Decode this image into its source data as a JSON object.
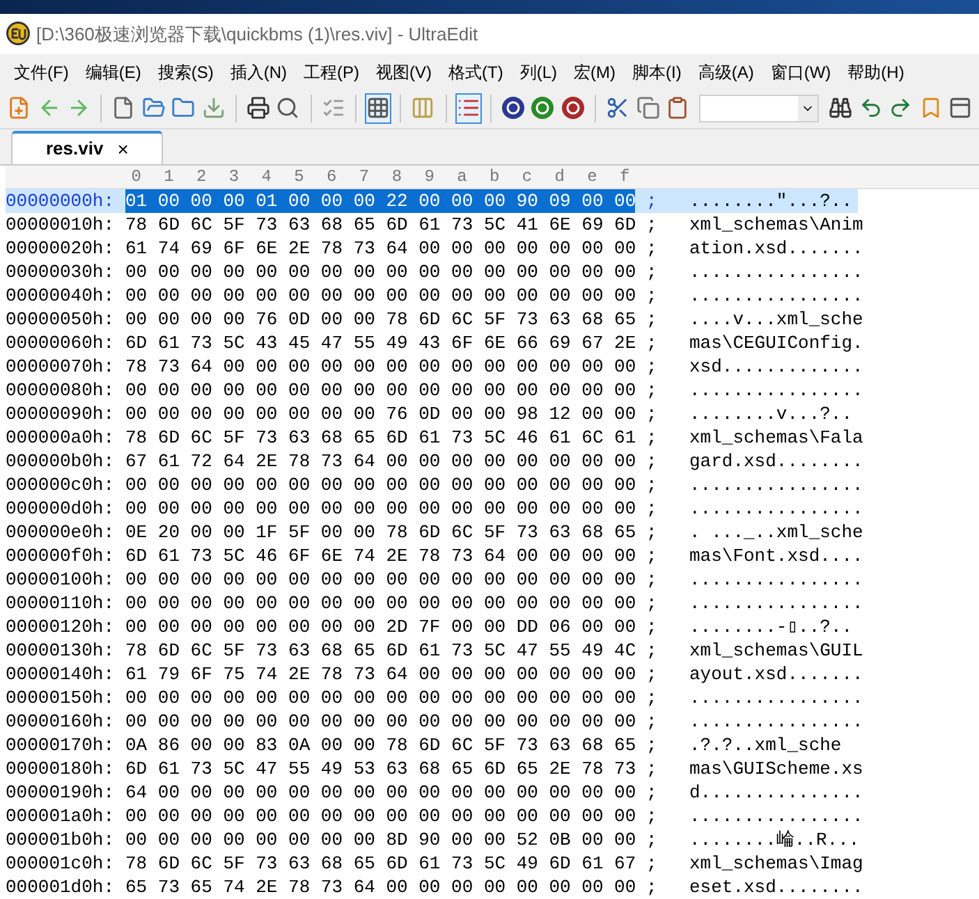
{
  "window": {
    "title": "[D:\\360极速浏览器下载\\quickbms (1)\\res.viv] - UltraEdit"
  },
  "menu": [
    "文件(F)",
    "编辑(E)",
    "搜索(S)",
    "插入(N)",
    "工程(P)",
    "视图(V)",
    "格式(T)",
    "列(L)",
    "宏(M)",
    "脚本(I)",
    "高级(A)",
    "窗口(W)",
    "帮助(H)"
  ],
  "toolbar": [
    {
      "kind": "new-template",
      "pressed": false
    },
    {
      "kind": "back",
      "pressed": false
    },
    {
      "kind": "forward",
      "pressed": false
    },
    {
      "kind": "sep"
    },
    {
      "kind": "new",
      "pressed": false
    },
    {
      "kind": "open",
      "pressed": false
    },
    {
      "kind": "folder",
      "pressed": false
    },
    {
      "kind": "save",
      "pressed": false
    },
    {
      "kind": "sep"
    },
    {
      "kind": "print",
      "pressed": false
    },
    {
      "kind": "preview",
      "pressed": false
    },
    {
      "kind": "sep"
    },
    {
      "kind": "list",
      "pressed": false
    },
    {
      "kind": "sep"
    },
    {
      "kind": "hex",
      "pressed": true
    },
    {
      "kind": "sep"
    },
    {
      "kind": "columns",
      "pressed": false
    },
    {
      "kind": "sep"
    },
    {
      "kind": "lines",
      "pressed": true
    },
    {
      "kind": "sep"
    },
    {
      "kind": "uc",
      "pressed": false
    },
    {
      "kind": "uf",
      "pressed": false
    },
    {
      "kind": "us",
      "pressed": false
    },
    {
      "kind": "sep"
    },
    {
      "kind": "cut",
      "pressed": false
    },
    {
      "kind": "copy",
      "pressed": false
    },
    {
      "kind": "paste",
      "pressed": false
    },
    {
      "kind": "combo"
    },
    {
      "kind": "find",
      "pressed": false
    },
    {
      "kind": "find-prev",
      "pressed": false
    },
    {
      "kind": "find-next",
      "pressed": false
    },
    {
      "kind": "bookmark",
      "pressed": false
    },
    {
      "kind": "panel",
      "pressed": false
    }
  ],
  "tabs": [
    {
      "label": "res.viv",
      "selected": true,
      "close": "×"
    }
  ],
  "ruler": [
    "0",
    "1",
    "2",
    "3",
    "4",
    "5",
    "6",
    "7",
    "8",
    "9",
    "a",
    "b",
    "c",
    "d",
    "e",
    "f"
  ],
  "rows": [
    {
      "address": "00000000h:",
      "hex": "01 00 00 00 01 00 00 00 22 00 00 00 90 09 00 00",
      "separator": ";",
      "ascii": "........\"...?..",
      "selected": true
    },
    {
      "address": "00000010h:",
      "hex": "78 6D 6C 5F 73 63 68 65 6D 61 73 5C 41 6E 69 6D",
      "separator": ";",
      "ascii": "xml_schemas\\Anim",
      "selected": false
    },
    {
      "address": "00000020h:",
      "hex": "61 74 69 6F 6E 2E 78 73 64 00 00 00 00 00 00 00",
      "separator": ";",
      "ascii": "ation.xsd.......",
      "selected": false
    },
    {
      "address": "00000030h:",
      "hex": "00 00 00 00 00 00 00 00 00 00 00 00 00 00 00 00",
      "separator": ";",
      "ascii": "................",
      "selected": false
    },
    {
      "address": "00000040h:",
      "hex": "00 00 00 00 00 00 00 00 00 00 00 00 00 00 00 00",
      "separator": ";",
      "ascii": "................",
      "selected": false
    },
    {
      "address": "00000050h:",
      "hex": "00 00 00 00 76 0D 00 00 78 6D 6C 5F 73 63 68 65",
      "separator": ";",
      "ascii": "....v...xml_sche",
      "selected": false
    },
    {
      "address": "00000060h:",
      "hex": "6D 61 73 5C 43 45 47 55 49 43 6F 6E 66 69 67 2E",
      "separator": ";",
      "ascii": "mas\\CEGUIConfig.",
      "selected": false
    },
    {
      "address": "00000070h:",
      "hex": "78 73 64 00 00 00 00 00 00 00 00 00 00 00 00 00",
      "separator": ";",
      "ascii": "xsd.............",
      "selected": false
    },
    {
      "address": "00000080h:",
      "hex": "00 00 00 00 00 00 00 00 00 00 00 00 00 00 00 00",
      "separator": ";",
      "ascii": "................",
      "selected": false
    },
    {
      "address": "00000090h:",
      "hex": "00 00 00 00 00 00 00 00 76 0D 00 00 98 12 00 00",
      "separator": ";",
      "ascii": "........v...?..",
      "selected": false
    },
    {
      "address": "000000a0h:",
      "hex": "78 6D 6C 5F 73 63 68 65 6D 61 73 5C 46 61 6C 61",
      "separator": ";",
      "ascii": "xml_schemas\\Fala",
      "selected": false
    },
    {
      "address": "000000b0h:",
      "hex": "67 61 72 64 2E 78 73 64 00 00 00 00 00 00 00 00",
      "separator": ";",
      "ascii": "gard.xsd........",
      "selected": false
    },
    {
      "address": "000000c0h:",
      "hex": "00 00 00 00 00 00 00 00 00 00 00 00 00 00 00 00",
      "separator": ";",
      "ascii": "................",
      "selected": false
    },
    {
      "address": "000000d0h:",
      "hex": "00 00 00 00 00 00 00 00 00 00 00 00 00 00 00 00",
      "separator": ";",
      "ascii": "................",
      "selected": false
    },
    {
      "address": "000000e0h:",
      "hex": "0E 20 00 00 1F 5F 00 00 78 6D 6C 5F 73 63 68 65",
      "separator": ";",
      "ascii": ". ..._..xml_sche",
      "selected": false
    },
    {
      "address": "000000f0h:",
      "hex": "6D 61 73 5C 46 6F 6E 74 2E 78 73 64 00 00 00 00",
      "separator": ";",
      "ascii": "mas\\Font.xsd....",
      "selected": false
    },
    {
      "address": "00000100h:",
      "hex": "00 00 00 00 00 00 00 00 00 00 00 00 00 00 00 00",
      "separator": ";",
      "ascii": "................",
      "selected": false
    },
    {
      "address": "00000110h:",
      "hex": "00 00 00 00 00 00 00 00 00 00 00 00 00 00 00 00",
      "separator": ";",
      "ascii": "................",
      "selected": false
    },
    {
      "address": "00000120h:",
      "hex": "00 00 00 00 00 00 00 00 2D 7F 00 00 DD 06 00 00",
      "separator": ";",
      "ascii": "........-▯..?..",
      "selected": false
    },
    {
      "address": "00000130h:",
      "hex": "78 6D 6C 5F 73 63 68 65 6D 61 73 5C 47 55 49 4C",
      "separator": ";",
      "ascii": "xml_schemas\\GUIL",
      "selected": false
    },
    {
      "address": "00000140h:",
      "hex": "61 79 6F 75 74 2E 78 73 64 00 00 00 00 00 00 00",
      "separator": ";",
      "ascii": "ayout.xsd.......",
      "selected": false
    },
    {
      "address": "00000150h:",
      "hex": "00 00 00 00 00 00 00 00 00 00 00 00 00 00 00 00",
      "separator": ";",
      "ascii": "................",
      "selected": false
    },
    {
      "address": "00000160h:",
      "hex": "00 00 00 00 00 00 00 00 00 00 00 00 00 00 00 00",
      "separator": ";",
      "ascii": "................",
      "selected": false
    },
    {
      "address": "00000170h:",
      "hex": "0A 86 00 00 83 0A 00 00 78 6D 6C 5F 73 63 68 65",
      "separator": ";",
      "ascii": ".?.?..xml_sche",
      "selected": false
    },
    {
      "address": "00000180h:",
      "hex": "6D 61 73 5C 47 55 49 53 63 68 65 6D 65 2E 78 73",
      "separator": ";",
      "ascii": "mas\\GUIScheme.xs",
      "selected": false
    },
    {
      "address": "00000190h:",
      "hex": "64 00 00 00 00 00 00 00 00 00 00 00 00 00 00 00",
      "separator": ";",
      "ascii": "d...............",
      "selected": false
    },
    {
      "address": "000001a0h:",
      "hex": "00 00 00 00 00 00 00 00 00 00 00 00 00 00 00 00",
      "separator": ";",
      "ascii": "................",
      "selected": false
    },
    {
      "address": "000001b0h:",
      "hex": "00 00 00 00 00 00 00 00 8D 90 00 00 52 0B 00 00",
      "separator": ";",
      "ascii": "........崘..R...",
      "selected": false
    },
    {
      "address": "000001c0h:",
      "hex": "78 6D 6C 5F 73 63 68 65 6D 61 73 5C 49 6D 61 67",
      "separator": ";",
      "ascii": "xml_schemas\\Imag",
      "selected": false
    },
    {
      "address": "000001d0h:",
      "hex": "65 73 65 74 2E 78 73 64 00 00 00 00 00 00 00 00",
      "separator": ";",
      "ascii": "eset.xsd........",
      "selected": false
    }
  ]
}
